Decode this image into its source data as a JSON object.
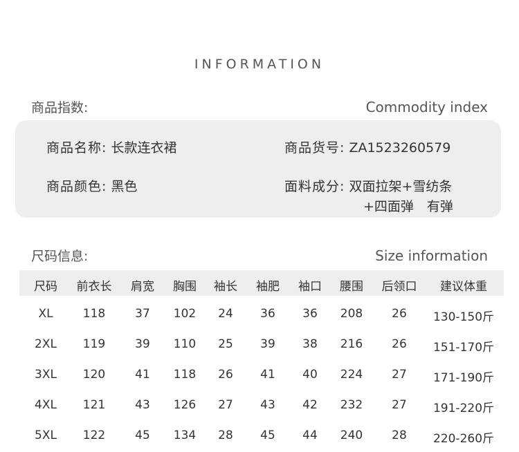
{
  "title": "INFORMATION",
  "commodity": {
    "heading_cn": "商品指数:",
    "heading_en": "Commodity index",
    "name_label": "商品名称:",
    "name_value": "长款连衣裙",
    "sku_label": "商品货号:",
    "sku_value": "ZA1523260579",
    "color_label": "商品颜色:",
    "color_value": "黑色",
    "material_label": "面料成分:",
    "material_value_line1": "双面拉架+雪纺条",
    "material_value_line2": "+四面弹　有弹"
  },
  "size": {
    "heading_cn": "尺码信息:",
    "heading_en": "Size information",
    "columns": [
      "尺码",
      "前衣长",
      "肩宽",
      "胸围",
      "袖长",
      "袖肥",
      "袖口",
      "腰围",
      "后领口",
      "建议体重"
    ],
    "rows": [
      [
        "XL",
        "118",
        "37",
        "102",
        "24",
        "36",
        "36",
        "208",
        "26",
        "130-150斤"
      ],
      [
        "2XL",
        "119",
        "39",
        "110",
        "25",
        "39",
        "38",
        "216",
        "26",
        "151-170斤"
      ],
      [
        "3XL",
        "120",
        "41",
        "118",
        "26",
        "41",
        "40",
        "224",
        "27",
        "171-190斤"
      ],
      [
        "4XL",
        "121",
        "43",
        "126",
        "27",
        "43",
        "42",
        "232",
        "27",
        "191-220斤"
      ],
      [
        "5XL",
        "122",
        "45",
        "134",
        "28",
        "45",
        "44",
        "240",
        "28",
        "220-260斤"
      ]
    ]
  }
}
